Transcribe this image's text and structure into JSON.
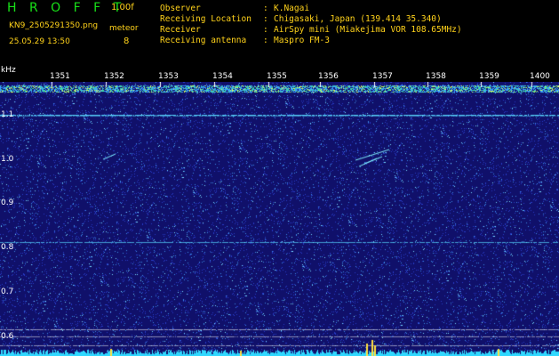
{
  "header": {
    "app_title": "H R O F F T",
    "version": "1.00f",
    "filename": "KN9_2505291350.png",
    "timestamp": "25.05.29 13:50",
    "meteor_label": "meteor",
    "meteor_count": "8"
  },
  "info": [
    {
      "label": "Observer",
      "value": "K.Nagai"
    },
    {
      "label": "Receiving Location",
      "value": "Chigasaki, Japan (139.414 35.340)"
    },
    {
      "label": "Receiver",
      "value": "AirSpy mini (Miakejima VOR 108.65MHz)"
    },
    {
      "label": "Receiving antenna",
      "value": "Maspro FM-3"
    }
  ],
  "axis": {
    "y_unit": "kHz",
    "y_ticks": [
      "1.1",
      "1.0",
      "0.9",
      "0.8",
      "0.7",
      "0.6"
    ],
    "x_ticks": [
      "1351",
      "1352",
      "1353",
      "1354",
      "1355",
      "1356",
      "1357",
      "1358",
      "1359",
      "1400"
    ]
  },
  "colors": {
    "background": "#10106a",
    "carrier": "#58d8ff",
    "text_yellow": "#ffd21a",
    "title_green": "#18e018"
  }
}
